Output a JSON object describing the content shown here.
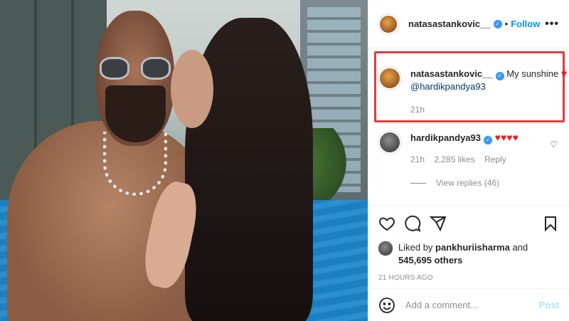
{
  "post": {
    "username": "natasastankovic__",
    "follow_label": "Follow",
    "more_label": "•••"
  },
  "caption": {
    "username": "natasastankovic__",
    "text": "My sunshine",
    "mention": "@hardikpandya93",
    "time": "21h"
  },
  "comment": {
    "username": "hardikpandya93",
    "hearts": "♥♥♥♥",
    "time": "21h",
    "likes": "2,285 likes",
    "reply_label": "Reply",
    "view_replies": "View replies (46)"
  },
  "likes": {
    "liked_by_prefix": "Liked by",
    "liked_by_user": "pankhuriisharma",
    "and": "and",
    "others": "545,695 others"
  },
  "timestamp": "21 HOURS AGO",
  "add_comment": {
    "placeholder": "Add a comment...",
    "post_label": "Post"
  },
  "colors": {
    "accent": "#0095f6",
    "highlight_box": "#e23b3b",
    "heart": "#ed1c24"
  },
  "icons": [
    "verified-badge-icon",
    "more-options-icon",
    "heart-icon",
    "comment-icon",
    "share-icon",
    "bookmark-icon",
    "emoji-icon"
  ]
}
